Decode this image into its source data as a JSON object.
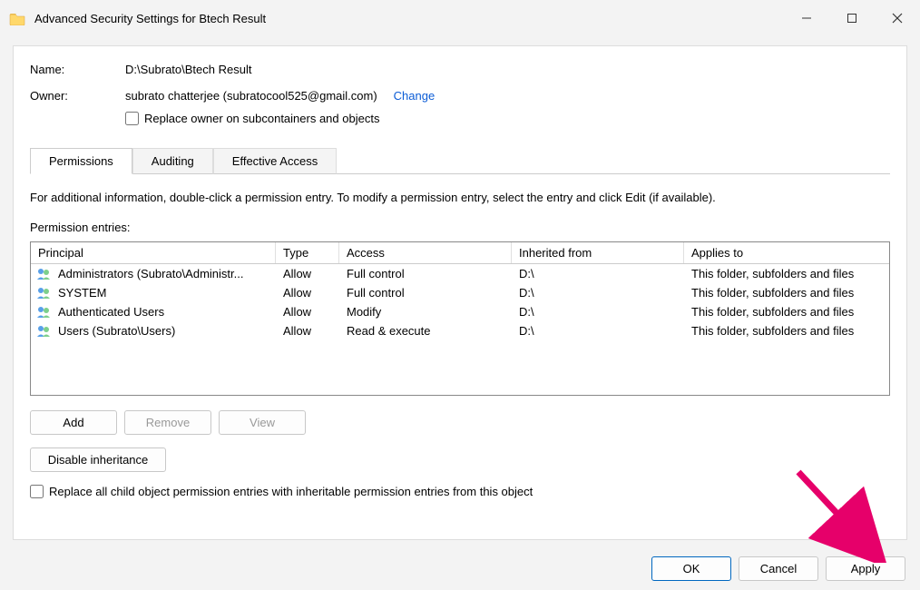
{
  "window": {
    "title": "Advanced Security Settings for Btech Result"
  },
  "header": {
    "name_label": "Name:",
    "name_value": "D:\\Subrato\\Btech Result",
    "owner_label": "Owner:",
    "owner_value": "subrato chatterjee (subratocool525@gmail.com)",
    "change_link": "Change",
    "replace_owner_label": "Replace owner on subcontainers and objects"
  },
  "tabs": {
    "permissions": "Permissions",
    "auditing": "Auditing",
    "effective": "Effective Access"
  },
  "perm": {
    "intro": "For additional information, double-click a permission entry. To modify a permission entry, select the entry and click Edit (if available).",
    "entries_label": "Permission entries:",
    "columns": {
      "principal": "Principal",
      "type": "Type",
      "access": "Access",
      "inherited": "Inherited from",
      "applies": "Applies to"
    },
    "rows": [
      {
        "principal": "Administrators (Subrato\\Administr...",
        "type": "Allow",
        "access": "Full control",
        "inherited": "D:\\",
        "applies": "This folder, subfolders and files"
      },
      {
        "principal": "SYSTEM",
        "type": "Allow",
        "access": "Full control",
        "inherited": "D:\\",
        "applies": "This folder, subfolders and files"
      },
      {
        "principal": "Authenticated Users",
        "type": "Allow",
        "access": "Modify",
        "inherited": "D:\\",
        "applies": "This folder, subfolders and files"
      },
      {
        "principal": "Users (Subrato\\Users)",
        "type": "Allow",
        "access": "Read & execute",
        "inherited": "D:\\",
        "applies": "This folder, subfolders and files"
      }
    ],
    "buttons": {
      "add": "Add",
      "remove": "Remove",
      "view": "View",
      "disable_inheritance": "Disable inheritance",
      "replace_child": "Replace all child object permission entries with inheritable permission entries from this object"
    }
  },
  "footer": {
    "ok": "OK",
    "cancel": "Cancel",
    "apply": "Apply"
  }
}
